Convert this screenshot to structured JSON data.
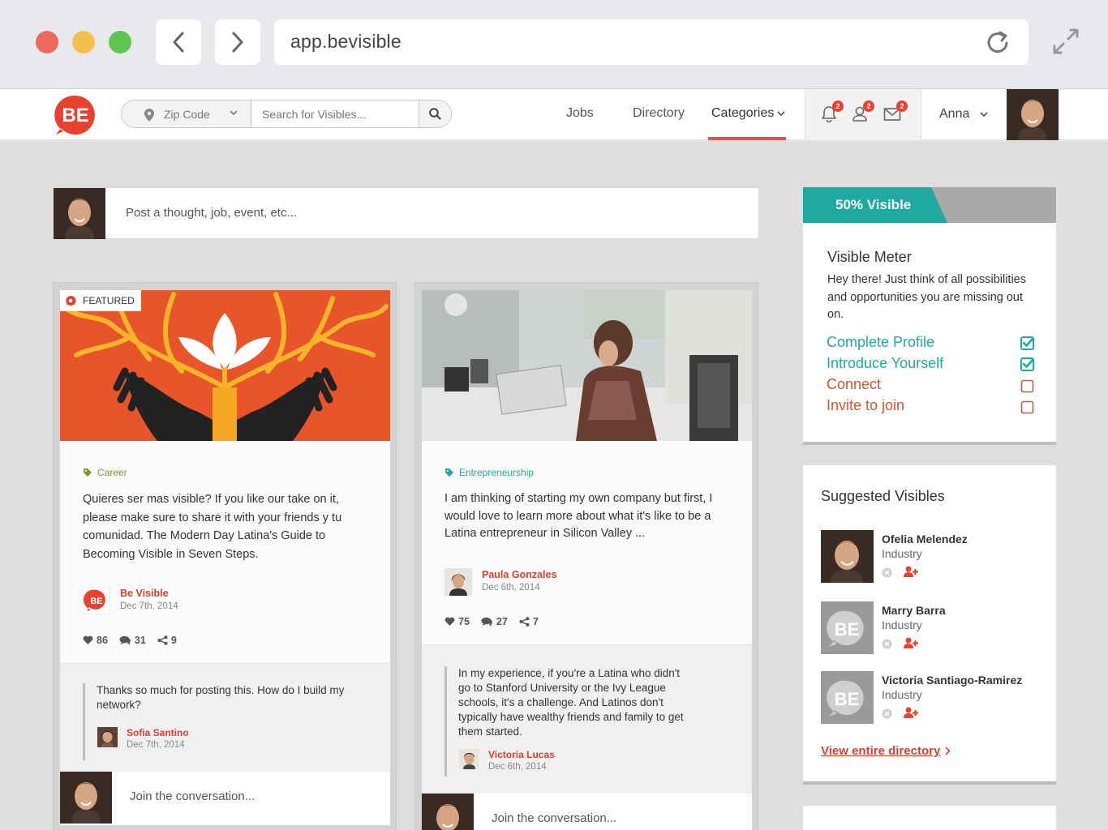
{
  "browser": {
    "url": "app.bevisible"
  },
  "nav": {
    "logo_text": "BE",
    "zip_placeholder": "Zip Code",
    "search_placeholder": "Search for Visibles...",
    "links": {
      "jobs": "Jobs",
      "directory": "Directory",
      "categories": "Categories"
    },
    "badges": {
      "notifications": "2",
      "connections": "2",
      "messages": "2"
    },
    "username": "Anna"
  },
  "composer": {
    "placeholder": "Post a thought, job, event, etc..."
  },
  "posts": [
    {
      "featured_label": "FEATURED",
      "tag": "Career",
      "body": "Quieres ser mas visible? If you like our take on it, please make sure to share it with your friends y tu comunidad. The Modern Day Latina's Guide to Becoming Visible in Seven Steps.",
      "author": "Be Visible",
      "date": "Dec 7th, 2014",
      "likes": "86",
      "comments": "31",
      "shares": "9",
      "reply": {
        "text": "Thanks so much for posting this. How do I build my network?",
        "author": "Sofia Santino",
        "date": "Dec 7th, 2014"
      },
      "join_placeholder": "Join the conversation..."
    },
    {
      "tag": "Entrepreneurship",
      "body": "I am thinking of starting my own company but first, I would love to learn more about what it's like to be a Latina entrepreneur in Silicon Valley ...",
      "author": "Paula Gonzales",
      "date": "Dec 6th, 2014",
      "likes": "75",
      "comments": "27",
      "shares": "7",
      "reply": {
        "text": "In my experience, if you're a Latina who didn't go to Stanford University or the Ivy League schools, it's a challenge. And Latinos don't typically have wealthy friends and family to get them started.",
        "author": "Victoria Lucas",
        "date": "Dec 6th, 2014"
      },
      "join_placeholder": "Join the conversation..."
    }
  ],
  "meter": {
    "label": "50% Visible",
    "percent": 50,
    "title": "Visible Meter",
    "description": "Hey there! Just think of all possibilities and opportunities you are missing out on.",
    "items": [
      {
        "label": "Complete Profile",
        "checked": true
      },
      {
        "label": "Introduce Yourself",
        "checked": true
      },
      {
        "label": "Connect",
        "checked": false
      },
      {
        "label": "Invite to join",
        "checked": false
      }
    ]
  },
  "suggested": {
    "title": "Suggested Visibles",
    "people": [
      {
        "name": "Ofelia Melendez",
        "industry": "Industry"
      },
      {
        "name": "Marry Barra",
        "industry": "Industry"
      },
      {
        "name": "Victoria Santiago-Ramirez",
        "industry": "Industry"
      }
    ],
    "view_all": "View entire directory"
  },
  "colors": {
    "brand_red": "#e8412f",
    "teal": "#1fa9a0",
    "link_red": "#d9412f",
    "career_green": "#7a9a2a"
  }
}
